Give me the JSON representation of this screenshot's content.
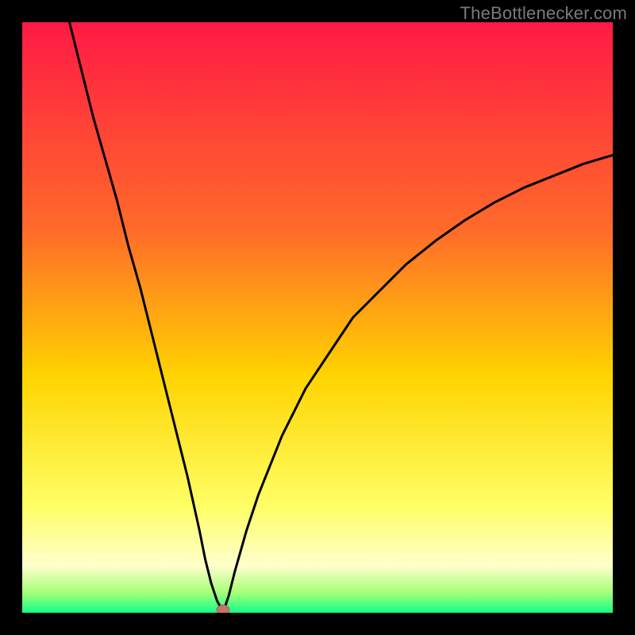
{
  "attribution": "TheBottlenecker.com",
  "colors": {
    "frame_bg": "#000000",
    "gradient_top": "#ff1a44",
    "gradient_mid1": "#ff6a2a",
    "gradient_mid2": "#ffd400",
    "gradient_low": "#ffff66",
    "gradient_lowmid": "#ffffcc",
    "gradient_base1": "#a8ff7a",
    "gradient_base2": "#13ff87",
    "curve": "#000000",
    "marker_fill": "#c7736a",
    "marker_stroke": "#a85a52"
  },
  "chart_data": {
    "type": "line",
    "title": "",
    "xlabel": "",
    "ylabel": "",
    "xlim": [
      0,
      100
    ],
    "ylim": [
      0,
      100
    ],
    "series": [
      {
        "name": "bottleneck-curve",
        "x": [
          8,
          10,
          12,
          14,
          16,
          18,
          20,
          22,
          24,
          26,
          28,
          30,
          31,
          32,
          33,
          33.8,
          34.2,
          35,
          36,
          38,
          40,
          44,
          48,
          52,
          56,
          60,
          65,
          70,
          75,
          80,
          85,
          90,
          95,
          100
        ],
        "y": [
          100,
          92,
          84,
          77,
          70,
          62,
          55,
          47,
          39,
          31,
          23,
          14,
          9,
          5,
          2,
          0.6,
          0.6,
          3,
          7,
          14,
          20,
          30,
          38,
          44,
          50,
          54,
          59,
          63,
          66.5,
          69.5,
          72,
          74,
          76,
          77.5
        ]
      }
    ],
    "marker": {
      "x": 34,
      "y": 0.5
    },
    "gradient_stops": [
      {
        "offset": 0.0,
        "color_key": "gradient_top"
      },
      {
        "offset": 0.35,
        "color_key": "gradient_mid1"
      },
      {
        "offset": 0.6,
        "color_key": "gradient_mid2"
      },
      {
        "offset": 0.82,
        "color_key": "gradient_low"
      },
      {
        "offset": 0.92,
        "color_key": "gradient_lowmid"
      },
      {
        "offset": 0.965,
        "color_key": "gradient_base1"
      },
      {
        "offset": 1.0,
        "color_key": "gradient_base2"
      }
    ]
  }
}
